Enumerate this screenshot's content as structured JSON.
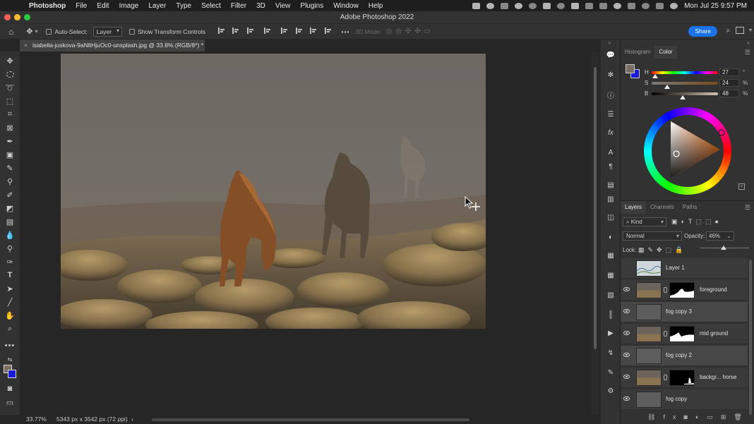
{
  "menubar": {
    "app": "Photoshop",
    "items": [
      "File",
      "Edit",
      "Image",
      "Layer",
      "Type",
      "Select",
      "Filter",
      "3D",
      "View",
      "Plugins",
      "Window",
      "Help"
    ],
    "clock": "Mon Jul 25  9:57 PM"
  },
  "window": {
    "title": "Adobe Photoshop 2022"
  },
  "options": {
    "auto_select_label": "Auto-Select:",
    "auto_select_value": "Layer",
    "transform_label": "Show Transform Controls",
    "mode_3d": "3D Mode:",
    "share": "Share"
  },
  "document": {
    "tab": "isabella-juskova-9aNltHjuOc0-unsplash.jpg @ 33.8% (RGB/8*) *"
  },
  "status": {
    "zoom": "33.77%",
    "dimensions": "5343 px x 3542 px (72 ppi)",
    "arrow": "›"
  },
  "color_panel": {
    "tabs": [
      "Histogram",
      "Color"
    ],
    "active_tab": "Color",
    "h_label": "H",
    "h_value": "27",
    "h_unit": "°",
    "s_label": "S",
    "s_value": "24",
    "s_unit": "%",
    "b_label": "B",
    "b_value": "48",
    "b_unit": "%",
    "foreground": "#7a6e64",
    "background": "#1a1adb"
  },
  "layers_panel": {
    "tabs": [
      "Layers",
      "Channels",
      "Paths"
    ],
    "active_tab": "Layers",
    "filter_kind": "Kind",
    "blend_mode": "Normal",
    "opacity_label": "Opacity:",
    "opacity_value": "46%",
    "lock_label": "Lock:",
    "layers": [
      {
        "name": "Layer 1",
        "visible": false,
        "mask": false
      },
      {
        "name": "foreground",
        "visible": true,
        "mask": true
      },
      {
        "name": "fog copy 3",
        "visible": true,
        "mask": false
      },
      {
        "name": "mid ground",
        "visible": true,
        "mask": true
      },
      {
        "name": "fog copy 2",
        "visible": true,
        "mask": false
      },
      {
        "name": "backgr... horse",
        "visible": true,
        "mask": true
      },
      {
        "name": "fog copy",
        "visible": true,
        "mask": false
      }
    ]
  }
}
